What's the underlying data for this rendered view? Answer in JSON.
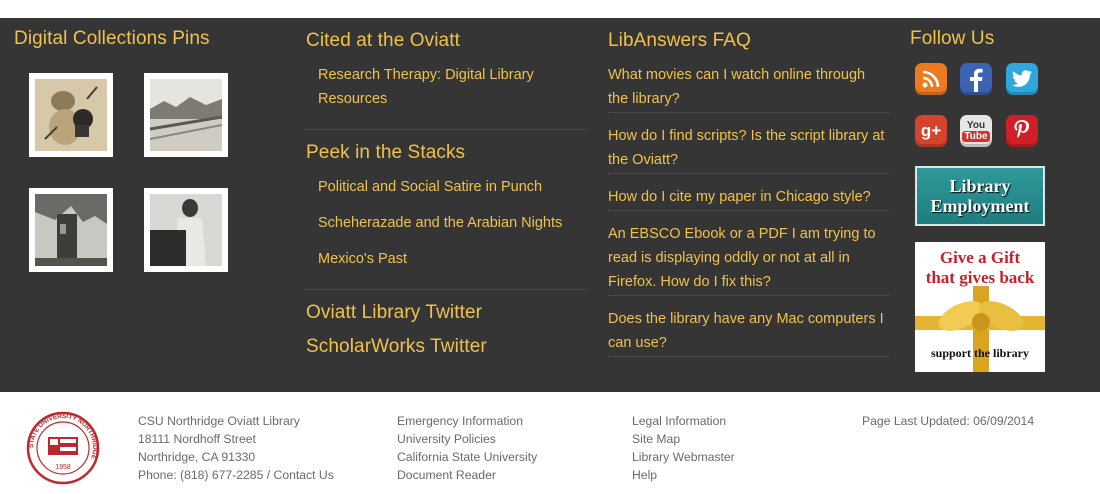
{
  "pins": {
    "heading": "Digital Collections Pins"
  },
  "cited": {
    "heading": "Cited at the Oviatt",
    "links": [
      "Research Therapy: Digital Library",
      "Resources"
    ]
  },
  "peek": {
    "heading": "Peek in the Stacks",
    "links": [
      "Political and Social Satire in Punch",
      "Scheherazade and the Arabian Nights",
      "Mexico's Past"
    ]
  },
  "twitter": {
    "oviatt": "Oviatt Library Twitter",
    "scholarworks": "ScholarWorks Twitter"
  },
  "faq": {
    "heading": "LibAnswers FAQ",
    "items": [
      {
        "l1": "What movies can I watch online through",
        "l2": "the library?"
      },
      {
        "l1": "How do I find scripts? Is the script library at",
        "l2": "the Oviatt?"
      },
      {
        "l1": "How do I cite my paper in Chicago style?"
      },
      {
        "l1": "An EBSCO Ebook or a PDF I am trying to",
        "l2": "read is displaying oddly or not at all in",
        "l3": "Firefox. How do I fix this?"
      },
      {
        "l1": "Does the library have any Mac computers I",
        "l2": "can use?"
      }
    ]
  },
  "follow": {
    "heading": "Follow Us",
    "youtube_top": "You",
    "youtube_bottom": "Tube",
    "employment": {
      "line1": "Library",
      "line2": "Employment"
    },
    "gift": {
      "line1": "Give a Gift",
      "line2": "that gives back",
      "line3": "support the library"
    }
  },
  "footer": {
    "address": [
      "CSU Northridge Oviatt Library",
      "18111 Nordhoff Street",
      "Northridge, CA 91330"
    ],
    "phone": "Phone: (818) 677-2285",
    "sep": " / ",
    "contact": "Contact Us",
    "col2": [
      "Emergency Information",
      "University Policies",
      "California State University",
      "Document Reader"
    ],
    "col3": [
      "Legal Information",
      "Site Map",
      "Library Webmaster",
      "Help"
    ],
    "updated": "Page Last Updated: 06/09/2014",
    "seal": {
      "ring": "STATE UNIVERSITY NORTHRIDGE",
      "year": "1958"
    }
  },
  "colors": {
    "dark": "#353535",
    "gold": "#f0c24a",
    "footer_text": "#6a6a6a",
    "seal": "#c0272d"
  }
}
